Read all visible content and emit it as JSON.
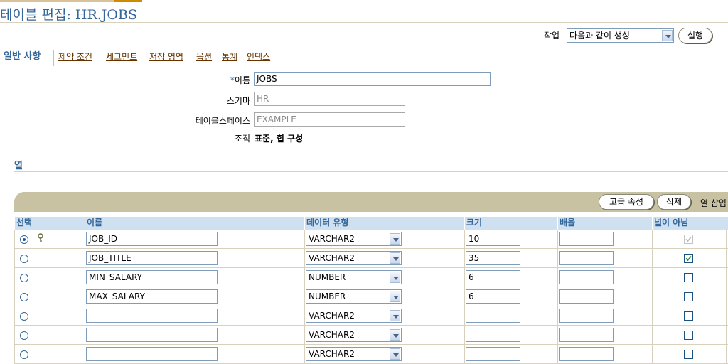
{
  "page": {
    "title": "테이블 편집: HR.JOBS"
  },
  "action": {
    "label": "작업",
    "selected": "다음과 같이 생성",
    "go_button": "실행"
  },
  "tabs": {
    "active": "일반 사항",
    "links": [
      "제약 조건",
      "세그먼트",
      "저장 영역",
      "옵션",
      "통계",
      "인덱스"
    ]
  },
  "general": {
    "name_required_mark": "*",
    "name_label": "이름",
    "name_value": "JOBS",
    "schema_label": "스키마",
    "schema_value": "HR",
    "tablespace_label": "테이블스페이스",
    "tablespace_value": "EXAMPLE",
    "organization_label": "조직",
    "organization_value": "표준, 힙 구성"
  },
  "columns_section": {
    "title": "열",
    "buttons": {
      "advanced": "고급 속성",
      "delete": "삭제"
    },
    "insert_label": "열 삽입",
    "headers": {
      "select": "선택",
      "name": "이름",
      "datatype": "데이터 유형",
      "size": "크기",
      "scale": "배율",
      "not_null": "널이 아님"
    },
    "rows": [
      {
        "selected": true,
        "key": true,
        "name": "JOB_ID",
        "datatype": "VARCHAR2",
        "size": "10",
        "scale": "",
        "not_null": true,
        "not_null_disabled": true
      },
      {
        "selected": false,
        "key": false,
        "name": "JOB_TITLE",
        "datatype": "VARCHAR2",
        "size": "35",
        "scale": "",
        "not_null": true,
        "not_null_disabled": false
      },
      {
        "selected": false,
        "key": false,
        "name": "MIN_SALARY",
        "datatype": "NUMBER",
        "size": "6",
        "scale": "",
        "not_null": false,
        "not_null_disabled": false
      },
      {
        "selected": false,
        "key": false,
        "name": "MAX_SALARY",
        "datatype": "NUMBER",
        "size": "6",
        "scale": "",
        "not_null": false,
        "not_null_disabled": false
      },
      {
        "selected": false,
        "key": false,
        "name": "",
        "datatype": "VARCHAR2",
        "size": "",
        "scale": "",
        "not_null": false,
        "not_null_disabled": false
      },
      {
        "selected": false,
        "key": false,
        "name": "",
        "datatype": "VARCHAR2",
        "size": "",
        "scale": "",
        "not_null": false,
        "not_null_disabled": false
      },
      {
        "selected": false,
        "key": false,
        "name": "",
        "datatype": "VARCHAR2",
        "size": "",
        "scale": "",
        "not_null": false,
        "not_null_disabled": false
      }
    ]
  },
  "icons": {
    "key": "key-icon",
    "dropdown": "chevron-down-icon",
    "check": "checkmark-icon"
  },
  "colors": {
    "accent": "#336699",
    "tab_link": "#663300",
    "table_band": "#c8c2a2",
    "header_bg": "#cfe0f1"
  }
}
